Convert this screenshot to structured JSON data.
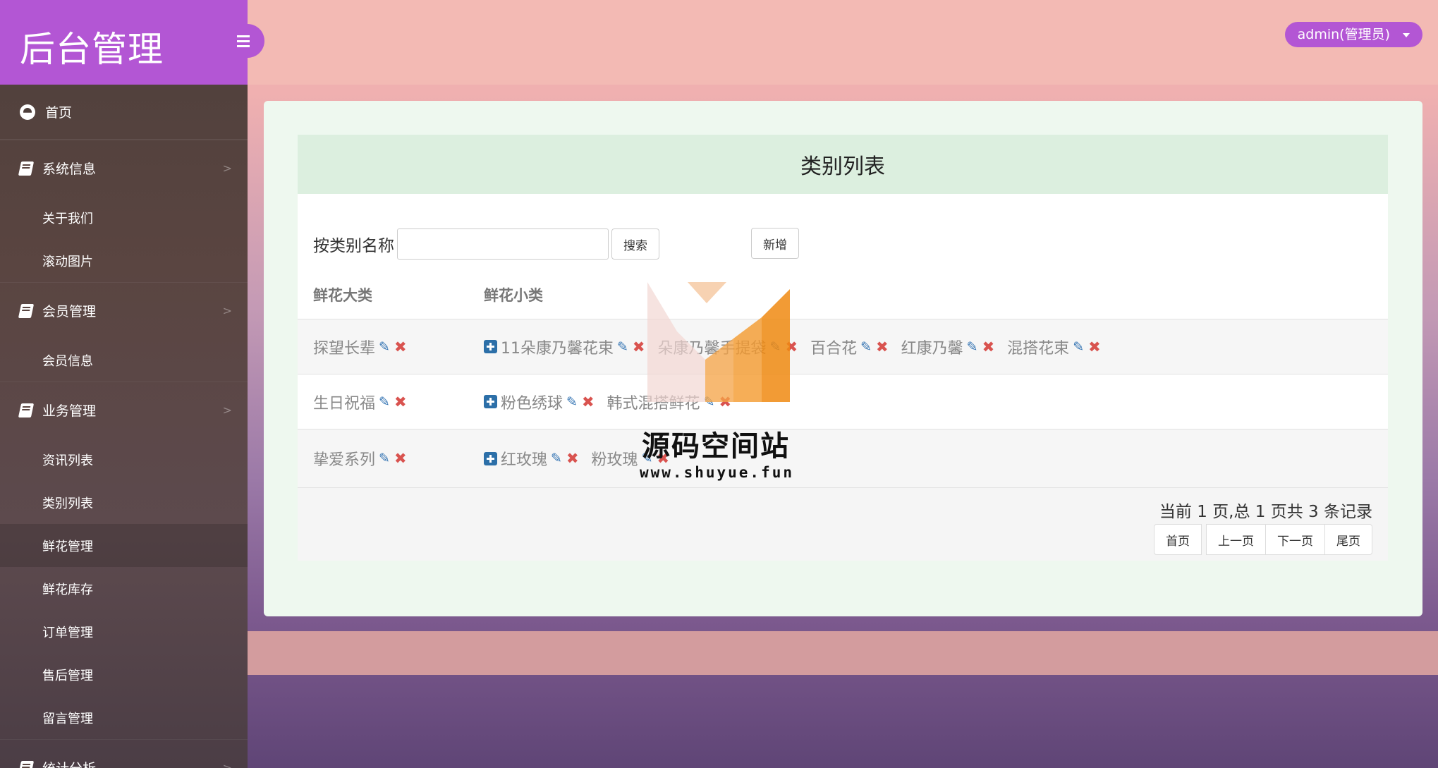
{
  "brand": {
    "title": "后台管理"
  },
  "user": {
    "label": "admin(管理员)"
  },
  "sidebar": {
    "home": "首页",
    "groups": [
      {
        "label": "系统信息",
        "items": [
          "关于我们",
          "滚动图片"
        ]
      },
      {
        "label": "会员管理",
        "items": [
          "会员信息"
        ]
      },
      {
        "label": "业务管理",
        "items": [
          "资讯列表",
          "类别列表",
          "鲜花管理",
          "鲜花库存",
          "订单管理",
          "售后管理",
          "留言管理"
        ]
      },
      {
        "label": "统计分析",
        "items": []
      }
    ],
    "active_item": "鲜花管理"
  },
  "page": {
    "title": "类别列表",
    "search_label": "按类别名称",
    "search_value": "",
    "search_button": "搜索",
    "add_button": "新增",
    "col_main": "鲜花大类",
    "col_sub": "鲜花小类",
    "rows": [
      {
        "main": "探望长辈",
        "subs": [
          "11朵康乃馨花束",
          "朵康乃馨手提袋",
          "百合花",
          "红康乃馨",
          "混搭花束"
        ]
      },
      {
        "main": "生日祝福",
        "subs": [
          "粉色绣球",
          "韩式混搭鲜花"
        ]
      },
      {
        "main": "挚爱系列",
        "subs": [
          "红玫瑰",
          "粉玫瑰"
        ]
      }
    ],
    "page_info": "当前 1 页,总 1 页共 3 条记录",
    "pager": [
      "首页",
      "上一页",
      "下一页",
      "尾页"
    ]
  },
  "watermark": {
    "name": "源码空间站",
    "url": "www.shuyue.fun"
  },
  "colors": {
    "accent": "#b356d4",
    "header_bg": "#dcefdf",
    "edit": "#3a78b5",
    "delete": "#d9534f"
  }
}
